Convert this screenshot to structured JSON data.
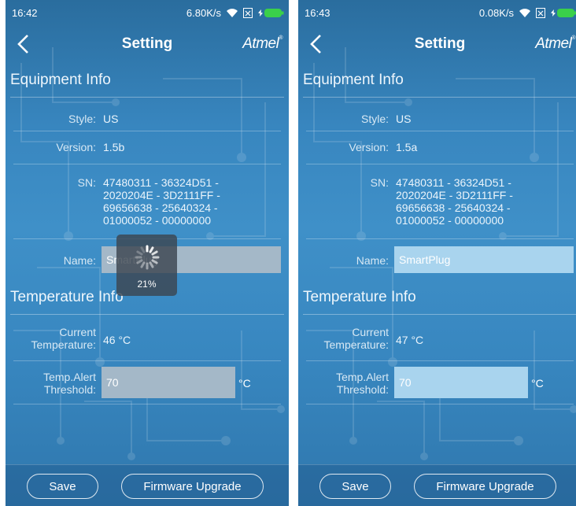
{
  "screens": [
    {
      "status": {
        "time": "16:42",
        "speed": "6.80K/s"
      },
      "nav": {
        "title": "Setting",
        "brand": "Atmel"
      },
      "equipment": {
        "header": "Equipment Info",
        "style_label": "Style:",
        "style_value": "US",
        "version_label": "Version:",
        "version_value": "1.5b",
        "sn_label": "SN:",
        "sn_value": "47480311 - 36324D51 - 2020204E - 3D2111FF - 69656638 - 25640324 - 01000052 - 00000000",
        "name_label": "Name:",
        "name_value": "SmartPlug"
      },
      "temperature": {
        "header": "Temperature Info",
        "current_label": "Current Temperature:",
        "current_value": "46 °C",
        "threshold_label": "Temp.Alert Threshold:",
        "threshold_value": "70",
        "unit": "°C"
      },
      "loading": {
        "text": "21%",
        "progress": 0.21
      },
      "buttons": {
        "save": "Save",
        "firmware": "Firmware Upgrade"
      }
    },
    {
      "status": {
        "time": "16:43",
        "speed": "0.08K/s"
      },
      "nav": {
        "title": "Setting",
        "brand": "Atmel"
      },
      "equipment": {
        "header": "Equipment Info",
        "style_label": "Style:",
        "style_value": "US",
        "version_label": "Version:",
        "version_value": "1.5a",
        "sn_label": "SN:",
        "sn_value": "47480311 - 36324D51 - 2020204E - 3D2111FF - 69656638 - 25640324 - 01000052 - 00000000",
        "name_label": "Name:",
        "name_value": "SmartPlug"
      },
      "temperature": {
        "header": "Temperature Info",
        "current_label": "Current Temperature:",
        "current_value": "47 °C",
        "threshold_label": "Temp.Alert Threshold:",
        "threshold_value": "70",
        "unit": "°C"
      },
      "buttons": {
        "save": "Save",
        "firmware": "Firmware Upgrade"
      }
    }
  ],
  "icons": [
    "back-arrow-icon",
    "wifi-icon",
    "sim-card-icon",
    "battery-charging-icon",
    "loading-spinner-icon"
  ],
  "colors": {
    "background_top": "#2a6d9e",
    "background_mid": "#3f90c8",
    "input_active": "#a9d4ee",
    "battery_green": "#3ad04a"
  }
}
